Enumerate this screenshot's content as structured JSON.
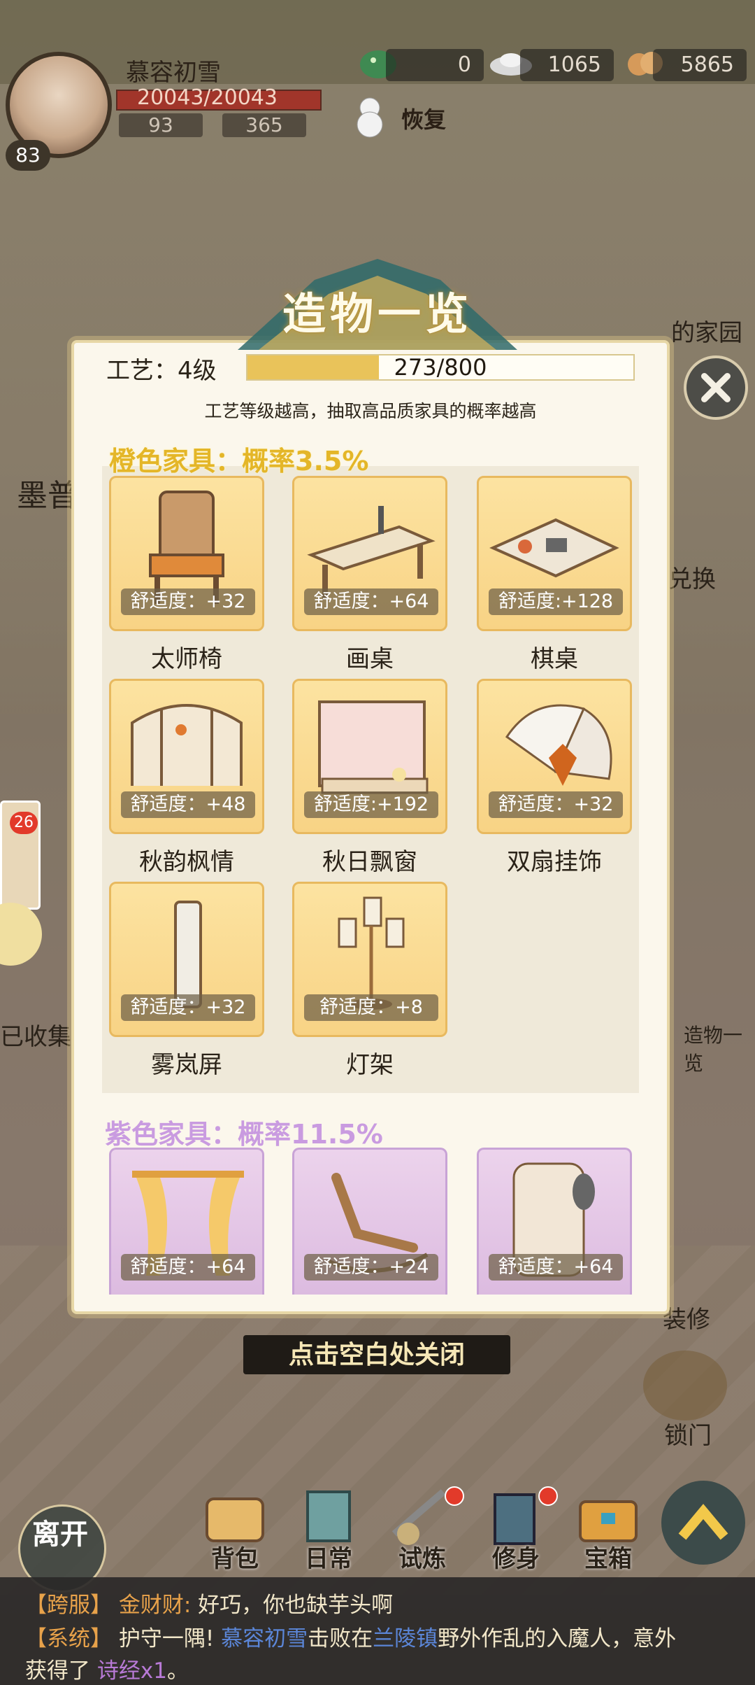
{
  "hud": {
    "player_name": "慕容初雪",
    "hp": "20043/20043",
    "level": "83",
    "stat_a": "93",
    "stat_b": "365",
    "currency_jade": "0",
    "currency_silver": "1065",
    "currency_copper": "5865",
    "restore_label": "恢复"
  },
  "side": {
    "left_tab": "墨普",
    "collected": "已收集",
    "card_badge": "26",
    "right_home": "的家园",
    "swap": "兑换",
    "overview": "造物一览",
    "repair": "装修",
    "lock": "锁门"
  },
  "panel": {
    "title": "造物一览",
    "craft_label": "工艺：4级",
    "craft_value": "273/800",
    "craft_progress": 0.34,
    "hint": "工艺等级越高，抽取高品质家具的概率越高",
    "orange_title": "橙色家具：概率3.5%",
    "purple_title": "紫色家具：概率11.5%",
    "orange_items": [
      {
        "name": "太师椅",
        "comfort": "舒适度：+32"
      },
      {
        "name": "画桌",
        "comfort": "舒适度：+64"
      },
      {
        "name": "棋桌",
        "comfort": "舒适度:+128"
      },
      {
        "name": "秋韵枫情",
        "comfort": "舒适度：+48"
      },
      {
        "name": "秋日飘窗",
        "comfort": "舒适度:+192"
      },
      {
        "name": "双扇挂饰",
        "comfort": "舒适度：+32"
      },
      {
        "name": "雾岚屏",
        "comfort": "舒适度：+32"
      },
      {
        "name": "灯架",
        "comfort": "舒适度：+8"
      }
    ],
    "purple_items": [
      {
        "comfort": "舒适度：+64"
      },
      {
        "comfort": "舒适度：+24"
      },
      {
        "comfort": "舒适度：+64"
      }
    ],
    "close_hint": "点击空白处关闭"
  },
  "bottom": {
    "leave": "离开",
    "bag": "背包",
    "daily": "日常",
    "trial": "试炼",
    "cultivate": "修身",
    "chest": "宝箱"
  },
  "chat": {
    "line1_tag": "【跨服】",
    "line1_speaker": "金财财:",
    "line1_text": "好巧，你也缺芋头啊",
    "line2_tag": "【系统】",
    "line2_a": "护守一隅!",
    "line2_name": "慕容初雪",
    "line2_b": "击败在",
    "line2_place": "兰陵镇",
    "line2_c": "野外作乱的入魔人，意外",
    "line3_a": "获得了",
    "line3_item": "诗经x1",
    "line3_end": "。"
  },
  "colors": {
    "orange_title": "#e4b628",
    "purple_title": "#c99be0",
    "card_orange": "#f8d385",
    "card_purple": "#dcbbe0",
    "hp_bar": "#a1352a",
    "craft_fill": "#e9c35a"
  }
}
